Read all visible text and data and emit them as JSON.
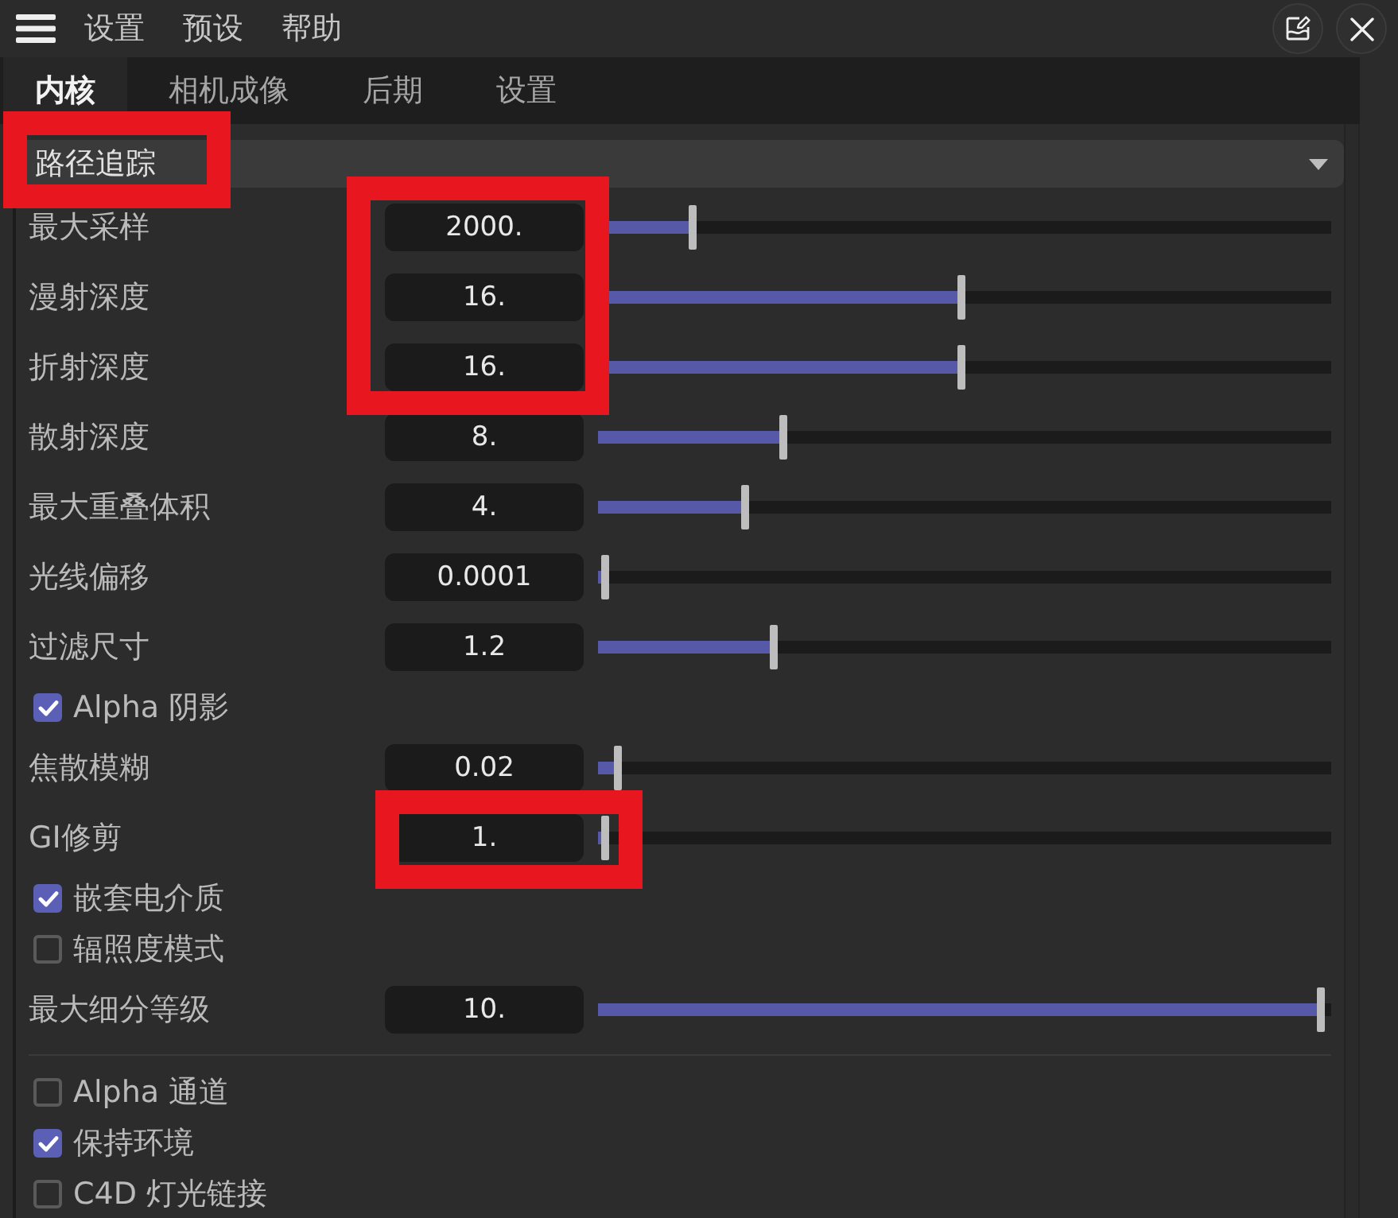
{
  "menu_bar": {
    "items": [
      "设置",
      "预设",
      "帮助"
    ]
  },
  "tabs": [
    {
      "label": "内核",
      "selected": true
    },
    {
      "label": "相机成像",
      "selected": false
    },
    {
      "label": "后期",
      "selected": false
    },
    {
      "label": "设置",
      "selected": false
    }
  ],
  "mode_dropdown": {
    "value": "路径追踪",
    "highlighted": true
  },
  "sections": [
    {
      "items": [
        {
          "kind": "slider",
          "label": "最大采样",
          "value": "2000.",
          "level": 0.13,
          "highlighted": true
        },
        {
          "kind": "slider",
          "label": "漫射深度",
          "value": "16.",
          "level": 0.495,
          "highlighted": true
        },
        {
          "kind": "slider",
          "label": "折射深度",
          "value": "16.",
          "level": 0.495,
          "highlighted": true
        },
        {
          "kind": "slider",
          "label": "散射深度",
          "value": "8.",
          "level": 0.252,
          "highlighted": false
        },
        {
          "kind": "slider",
          "label": "最大重叠体积",
          "value": "4.",
          "level": 0.2,
          "highlighted": false
        },
        {
          "kind": "slider",
          "label": "光线偏移",
          "value": "0.0001",
          "level": 0.01,
          "highlighted": false
        },
        {
          "kind": "slider",
          "label": "过滤尺寸",
          "value": "1.2",
          "level": 0.24,
          "highlighted": false
        },
        {
          "kind": "checkbox",
          "label": "Alpha 阴影",
          "checked": true
        },
        {
          "kind": "slider",
          "label": "焦散模糊",
          "value": "0.02",
          "level": 0.028,
          "highlighted": false
        },
        {
          "kind": "slider",
          "label": "GI修剪",
          "value": "1.",
          "level": 0.01,
          "highlighted": true
        },
        {
          "kind": "checkbox",
          "label": "嵌套电介质",
          "checked": true
        },
        {
          "kind": "checkbox",
          "label": "辐照度模式",
          "checked": false
        },
        {
          "kind": "slider",
          "label": "最大细分等级",
          "value": "10.",
          "level": 0.985,
          "highlighted": false
        }
      ]
    },
    {
      "items": [
        {
          "kind": "checkbox",
          "label": "Alpha 通道",
          "checked": false
        },
        {
          "kind": "checkbox",
          "label": "保持环境",
          "checked": true
        },
        {
          "kind": "checkbox",
          "label": "C4D 灯光链接",
          "checked": false
        }
      ]
    }
  ]
}
